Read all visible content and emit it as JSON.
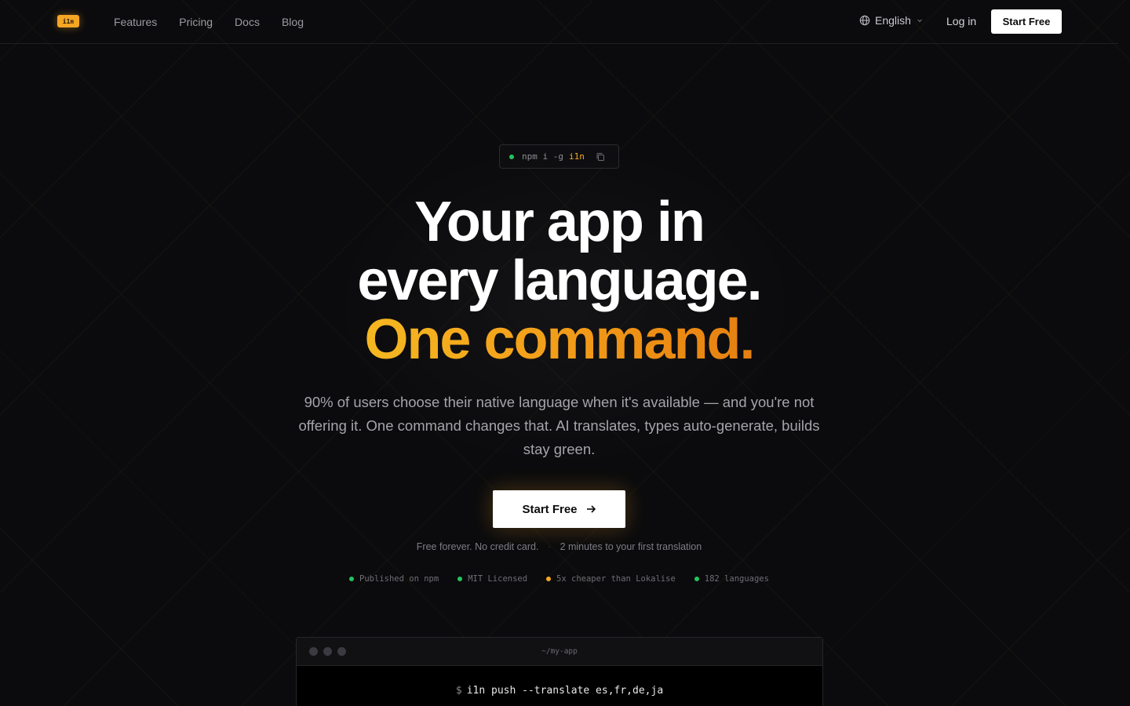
{
  "nav": {
    "logo": "i1n",
    "links": [
      "Features",
      "Pricing",
      "Docs",
      "Blog"
    ],
    "language": "English",
    "login": "Log in",
    "start": "Start Free"
  },
  "install": {
    "command": "npm i -g",
    "package": "i1n"
  },
  "hero": {
    "line1": "Your app in",
    "line2": "every language.",
    "line3": "One command.",
    "subtitle": "90% of users choose their native language when it's available — and you're not offering it. One command changes that. AI translates, types auto-generate, builds stay green.",
    "cta": "Start Free",
    "note1": "Free forever. No credit card.",
    "note_sep": "·",
    "note2": "2 minutes to your first translation"
  },
  "badges": [
    {
      "label": "Published on npm",
      "color": "#22c55e"
    },
    {
      "label": "MIT Licensed",
      "color": "#22c55e"
    },
    {
      "label": "5x cheaper than Lokalise",
      "color": "#f5a623"
    },
    {
      "label": "182 languages",
      "color": "#22c55e"
    }
  ],
  "terminal": {
    "title": "~/my-app",
    "prompt": "$",
    "command": "i1n push --translate es,fr,de,ja"
  },
  "colors": {
    "accent": "#f5a623",
    "success": "#22c55e",
    "background": "#0b0b0d"
  }
}
